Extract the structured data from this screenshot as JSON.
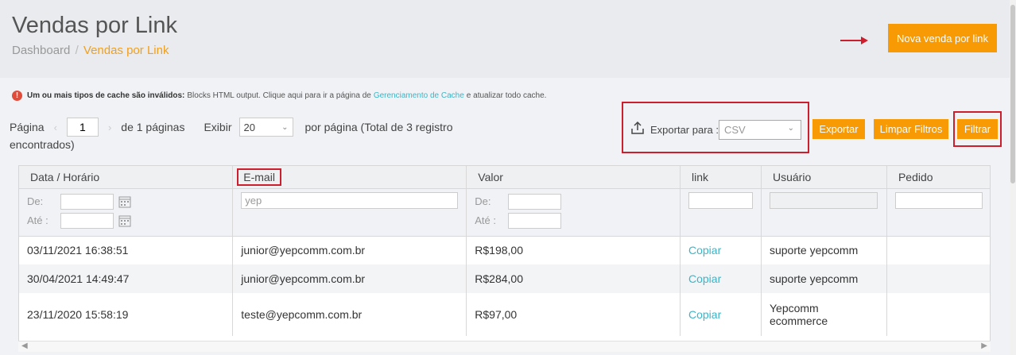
{
  "header": {
    "title": "Vendas por Link",
    "breadcrumb": {
      "root": "Dashboard",
      "separator": "/",
      "current": "Vendas por Link"
    },
    "new_sale_label": "Nova venda por link"
  },
  "cache_notice": {
    "bold": "Um ou mais tipos de cache são inválidos:",
    "text_before": "Blocks HTML output. Clique aqui para ir a página de",
    "link": "Gerenciamento de Cache",
    "text_after": "e atualizar todo cache."
  },
  "pager": {
    "page_label": "Página",
    "page_value": "1",
    "of_text": "de 1 páginas",
    "show_label": "Exibir",
    "per_page": "20",
    "per_page_text": "por página (Total de 3 registro",
    "found_text": "encontrados)"
  },
  "export": {
    "label": "Exportar para :",
    "format": "CSV",
    "export_btn": "Exportar"
  },
  "actions": {
    "clear_filters": "Limpar Filtros",
    "filter": "Filtrar"
  },
  "grid": {
    "columns": [
      "Data / Horário",
      "E-mail",
      "Valor",
      "link",
      "Usuário",
      "Pedido"
    ],
    "filters": {
      "from_label": "De:",
      "to_label": "Até :",
      "email_value": "yep",
      "valor_from_label": "De:",
      "valor_to_label": "Até :"
    },
    "rows": [
      {
        "date": "03/11/2021 16:38:51",
        "email": "junior@yepcomm.com.br",
        "valor": "R$198,00",
        "link": "Copiar",
        "usuario": "suporte yepcomm",
        "pedido": ""
      },
      {
        "date": "30/04/2021 14:49:47",
        "email": "junior@yepcomm.com.br",
        "valor": "R$284,00",
        "link": "Copiar",
        "usuario": "suporte yepcomm",
        "pedido": ""
      },
      {
        "date": "23/11/2020 15:58:19",
        "email": "teste@yepcomm.com.br",
        "valor": "R$97,00",
        "link": "Copiar",
        "usuario": "Yepcomm ecommerce",
        "pedido": ""
      }
    ]
  },
  "colors": {
    "accent": "#f79a03",
    "link": "#3bb5c8",
    "highlight": "#cc1e2d"
  }
}
